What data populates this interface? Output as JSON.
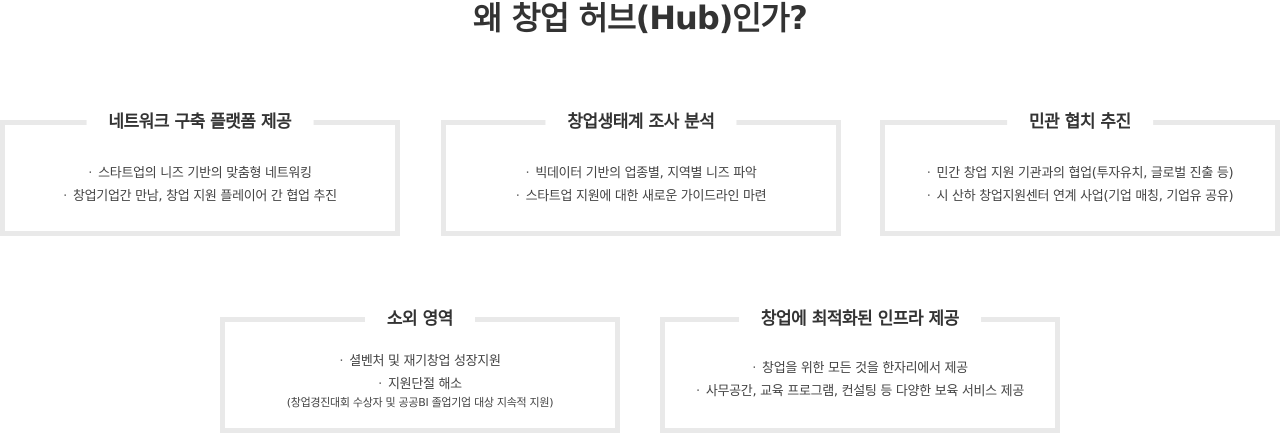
{
  "page": {
    "title": "왜 창업 허브(Hub)인가?"
  },
  "bullet_symbol": "·",
  "cards": [
    {
      "title": "네트워크 구축 플랫폼 제공",
      "items": [
        "스타트업의 니즈 기반의 맞춤형 네트워킹",
        "창업기업간 만남, 창업 지원 플레이어 간 협업 추진"
      ]
    },
    {
      "title": "창업생태계 조사 분석",
      "items": [
        "빅데이터 기반의 업종별, 지역별 니즈 파악",
        "스타트업 지원에 대한 새로운 가이드라인 마련"
      ]
    },
    {
      "title": "민관 협치 추진",
      "items": [
        "민간 창업 지원 기관과의 협업(투자유치, 글로벌 진출 등)",
        "시 산하 창업지원센터 연계 사업(기업 매칭, 기업유 공유)"
      ]
    },
    {
      "title": "소외 영역",
      "items": [
        "셜벤처 및 재기창업 성장지원",
        "지원단절 해소"
      ],
      "note": "(창업경진대회 수상자 및 공공BI 졸업기업 대상 지속적 지원)"
    },
    {
      "title": "창업에 최적화된 인프라 제공",
      "items": [
        "창업을 위한 모든 것을 한자리에서 제공",
        "사무공간, 교육 프로그램, 컨설팅 등 다양한 보육 서비스 제공"
      ]
    }
  ]
}
